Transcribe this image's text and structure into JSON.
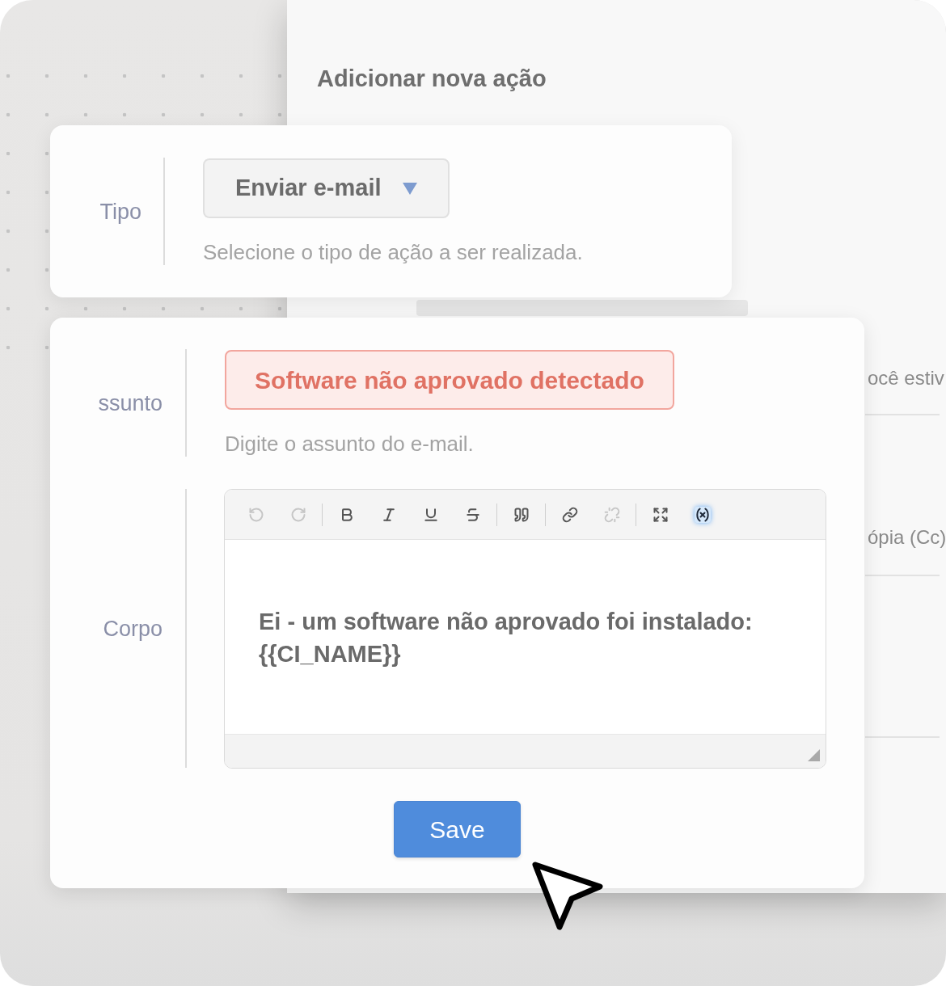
{
  "background_panel": {
    "title": "Adicionar nova ação",
    "partial_lines": [
      "ocê estiv",
      "ópia (Cc)"
    ]
  },
  "type_card": {
    "label": "Tipo",
    "dropdown": {
      "value": "Enviar e-mail"
    },
    "help": "Selecione o tipo de ação a ser realizada."
  },
  "email_card": {
    "subject": {
      "label": "ssunto",
      "value": "Software não aprovado detectado",
      "invalid": true,
      "help": "Digite o assunto do e-mail."
    },
    "body": {
      "label": "Corpo",
      "toolbar": [
        {
          "kind": "undo",
          "disabled": true,
          "on": false
        },
        {
          "kind": "redo",
          "disabled": true,
          "on": false
        },
        {
          "kind": "separator"
        },
        {
          "kind": "bold",
          "disabled": false,
          "on": false
        },
        {
          "kind": "italic",
          "disabled": false,
          "on": false
        },
        {
          "kind": "underline",
          "disabled": false,
          "on": false
        },
        {
          "kind": "strike",
          "disabled": false,
          "on": false
        },
        {
          "kind": "separator"
        },
        {
          "kind": "quote",
          "disabled": false,
          "on": false
        },
        {
          "kind": "separator"
        },
        {
          "kind": "link",
          "disabled": false,
          "on": false
        },
        {
          "kind": "unlink",
          "disabled": true,
          "on": false
        },
        {
          "kind": "separator"
        },
        {
          "kind": "maximize",
          "disabled": false,
          "on": false
        },
        {
          "kind": "variable",
          "disabled": false,
          "on": true
        }
      ],
      "value": "Ei - um software não aprovado foi instalado: {{CI_NAME}}"
    },
    "save_button": {
      "label": "Save"
    }
  }
}
